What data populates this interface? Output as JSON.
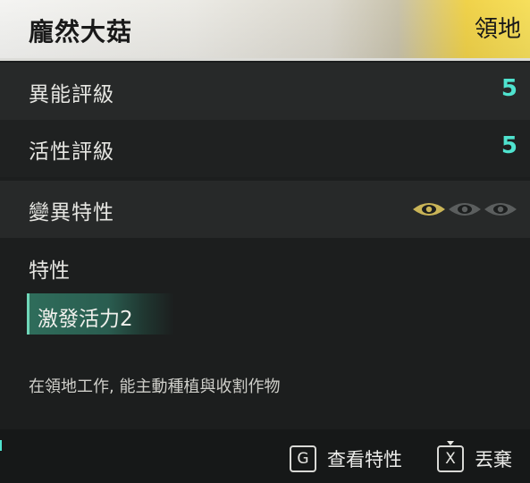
{
  "header": {
    "title": "龐然大菇",
    "tag": "領地"
  },
  "stats": [
    {
      "label": "異能評級",
      "value": "5"
    },
    {
      "label": "活性評級",
      "value": "5"
    },
    {
      "label": "變異特性",
      "level": 1,
      "max": 3
    }
  ],
  "traits": {
    "label": "特性",
    "chip": "激發活力2",
    "description": "在領地工作, 能主動種植與收割作物"
  },
  "footer": {
    "hints": [
      {
        "key": "G",
        "label": "查看特性"
      },
      {
        "key": "X",
        "label": "丟棄"
      }
    ]
  },
  "colors": {
    "accent": "#4fe3cf",
    "eye_active": "#c9b457",
    "eye_inactive": "#5b5e5e",
    "chip": "#2f6d5b"
  },
  "icons": {
    "eye": "eye-icon"
  }
}
